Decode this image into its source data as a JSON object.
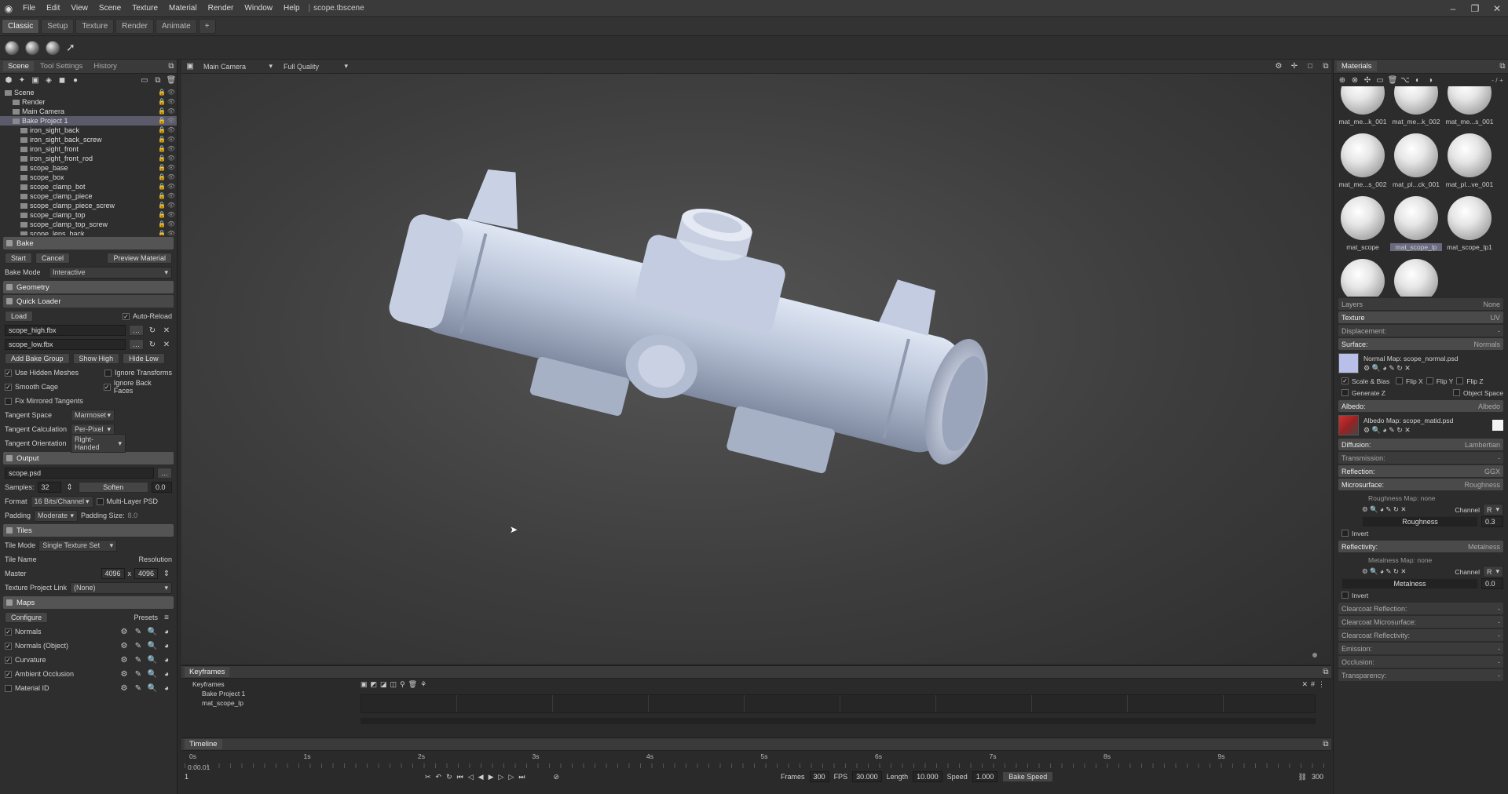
{
  "titlebar": {
    "menus": [
      "File",
      "Edit",
      "View",
      "Scene",
      "Texture",
      "Material",
      "Render",
      "Window",
      "Help"
    ],
    "doc": "scope.tbscene"
  },
  "modes": [
    "Classic",
    "Setup",
    "Texture",
    "Render",
    "Animate",
    "+"
  ],
  "scene_panel": {
    "tabs": [
      "Scene",
      "Tool Settings",
      "History"
    ],
    "tree": [
      {
        "label": "Scene",
        "depth": 0
      },
      {
        "label": "Render",
        "depth": 1
      },
      {
        "label": "Main Camera",
        "depth": 1
      },
      {
        "label": "Bake Project 1",
        "depth": 1,
        "selected": true
      },
      {
        "label": "iron_sight_back",
        "depth": 2
      },
      {
        "label": "iron_sight_back_screw",
        "depth": 2
      },
      {
        "label": "iron_sight_front",
        "depth": 2
      },
      {
        "label": "iron_sight_front_rod",
        "depth": 2
      },
      {
        "label": "scope_base",
        "depth": 2
      },
      {
        "label": "scope_box",
        "depth": 2
      },
      {
        "label": "scope_clamp_bot",
        "depth": 2
      },
      {
        "label": "scope_clamp_piece",
        "depth": 2
      },
      {
        "label": "scope_clamp_piece_screw",
        "depth": 2
      },
      {
        "label": "scope_clamp_top",
        "depth": 2
      },
      {
        "label": "scope_clamp_top_screw",
        "depth": 2
      },
      {
        "label": "scope_lens_back",
        "depth": 2
      }
    ]
  },
  "bake": {
    "title": "Bake",
    "start": "Start",
    "cancel": "Cancel",
    "preview": "Preview Material",
    "mode_label": "Bake Mode",
    "mode": "Interactive",
    "geometry": "Geometry",
    "quick_loader": "Quick Loader",
    "load": "Load",
    "auto_reload": "Auto-Reload",
    "high": "scope_high.fbx",
    "low": "scope_low.fbx",
    "add_group": "Add Bake Group",
    "show_high": "Show High",
    "hide_low": "Hide Low",
    "hidden_meshes": "Use Hidden Meshes",
    "ignore_transforms": "Ignore Transforms",
    "smooth_cage": "Smooth Cage",
    "ignore_back": "Ignore Back Faces",
    "fix_mirrored": "Fix Mirrored Tangents",
    "tangent_space_label": "Tangent Space",
    "tangent_space": "Marmoset",
    "tangent_calc_label": "Tangent Calculation",
    "tangent_calc": "Per-Pixel",
    "tangent_orient_label": "Tangent Orientation",
    "tangent_orient": "Right-Handed",
    "output": "Output",
    "output_file": "scope.psd",
    "samples_label": "Samples:",
    "samples": "32",
    "soften": "Soften",
    "soften_val": "0.0",
    "format_label": "Format",
    "format": "16 Bits/Channel",
    "multilayer": "Multi-Layer PSD",
    "padding_label": "Padding",
    "padding": "Moderate",
    "padding_size_label": "Padding Size:",
    "padding_size": "8.0",
    "tiles": "Tiles",
    "tile_mode_label": "Tile Mode",
    "tile_mode": "Single Texture Set",
    "tile_name": "Tile Name",
    "resolution": "Resolution",
    "master": "Master",
    "res_w": "4096",
    "res_x": "x",
    "res_h": "4096",
    "tex_link_label": "Texture Project Link",
    "tex_link": "(None)",
    "maps": "Maps",
    "configure": "Configure",
    "presets": "Presets",
    "map_list": [
      "Normals",
      "Normals (Object)",
      "Curvature",
      "Ambient Occlusion",
      "Material ID"
    ]
  },
  "viewport": {
    "camera": "Main Camera",
    "quality": "Full Quality"
  },
  "materials": {
    "title": "Materials",
    "counter": "- / +",
    "thumbs": [
      {
        "name": "mat_me...k_001"
      },
      {
        "name": "mat_me...k_002"
      },
      {
        "name": "mat_me...s_001"
      },
      {
        "name": "mat_me...s_002"
      },
      {
        "name": "mat_pl...ck_001"
      },
      {
        "name": "mat_pl...ve_001"
      },
      {
        "name": "mat_scope"
      },
      {
        "name": "mat_scope_lp",
        "selected": true
      },
      {
        "name": "mat_scope_lp1"
      }
    ]
  },
  "props": {
    "layers": "Layers",
    "layers_val": "None",
    "texture": "Texture",
    "texture_val": "UV",
    "displacement": "Displacement:",
    "surface": "Surface:",
    "surface_val": "Normals",
    "normal_map": "Normal Map: scope_normal.psd",
    "scale_bias": "Scale & Bias",
    "flipx": "Flip X",
    "flipy": "Flip Y",
    "flipz": "Flip Z",
    "gen_z": "Generate Z",
    "object_space": "Object Space",
    "albedo": "Albedo:",
    "albedo_val": "Albedo",
    "albedo_map": "Albedo Map: scope_matid.psd",
    "diffusion": "Diffusion:",
    "diffusion_val": "Lambertian",
    "transmission": "Transmission:",
    "reflection": "Reflection:",
    "reflection_val": "GGX",
    "microsurface": "Microsurface:",
    "microsurface_val": "Roughness",
    "rough_map": "Roughness Map: none",
    "channel": "Channel",
    "channel_val": "R",
    "roughness": "Roughness",
    "roughness_val": "0.3",
    "invert": "Invert",
    "reflectivity": "Reflectivity:",
    "reflectivity_val": "Metalness",
    "metal_map": "Metalness Map: none",
    "metalness": "Metalness",
    "metalness_val": "0.0",
    "cc_refl": "Clearcoat Reflection:",
    "cc_micro": "Clearcoat Microsurface:",
    "cc_reflectivity": "Clearcoat Reflectivity:",
    "emission": "Emission:",
    "occlusion": "Occlusion:",
    "transparency": "Transparency:",
    "dash": "-"
  },
  "keyframes": {
    "title": "Keyframes",
    "items": [
      "Keyframes",
      "Bake Project 1",
      "mat_scope_lp"
    ]
  },
  "timeline": {
    "title": "Timeline",
    "ticks": [
      "0s",
      "1s",
      "2s",
      "3s",
      "4s",
      "5s",
      "6s",
      "7s",
      "8s",
      "9s"
    ],
    "current": "0:00.01",
    "frame": "1",
    "frames_label": "Frames",
    "frames": "300",
    "fps_label": "FPS",
    "fps": "30.000",
    "length_label": "Length",
    "length": "10.000",
    "speed_label": "Speed",
    "speed": "1.000",
    "bake_speed": "Bake Speed",
    "end": "300"
  }
}
